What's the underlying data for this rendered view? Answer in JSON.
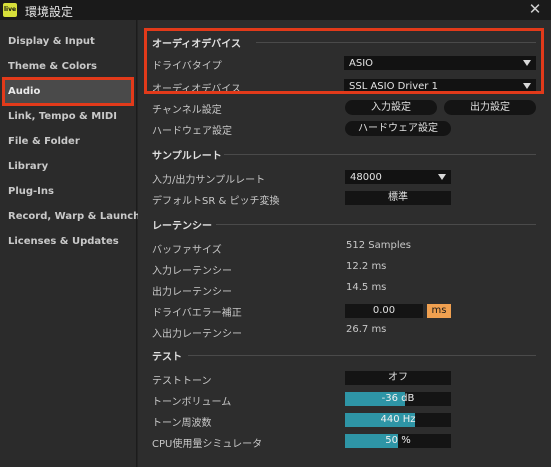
{
  "window": {
    "title": "環境設定",
    "app_icon_text": "live"
  },
  "sidebar": {
    "items": [
      {
        "label": "Display & Input"
      },
      {
        "label": "Theme & Colors"
      },
      {
        "label": "Audio",
        "active": true
      },
      {
        "label": "Link, Tempo & MIDI"
      },
      {
        "label": "File & Folder"
      },
      {
        "label": "Library"
      },
      {
        "label": "Plug-Ins"
      },
      {
        "label": "Record, Warp & Launch"
      },
      {
        "label": "Licenses & Updates"
      }
    ]
  },
  "audio_device": {
    "heading": "オーディオデバイス",
    "driver_type_label": "ドライバタイプ",
    "driver_type_value": "ASIO",
    "device_label": "オーディオデバイス",
    "device_value": "SSL ASIO Driver 1",
    "channel_label": "チャンネル設定",
    "input_settings": "入力設定",
    "output_settings": "出力設定",
    "hardware_label": "ハードウェア設定",
    "hardware_button": "ハードウェア設定"
  },
  "sample_rate": {
    "heading": "サンプルレート",
    "io_label": "入力/出力サンプルレート",
    "io_value": "48000",
    "default_label": "デフォルトSR & ピッチ変換",
    "default_value": "標準"
  },
  "latency": {
    "heading": "レーテンシー",
    "buffer_label": "バッファサイズ",
    "buffer_value": "512 Samples",
    "input_label": "入力レーテンシー",
    "input_value": "12.2 ms",
    "output_label": "出力レーテンシー",
    "output_value": "14.5 ms",
    "driver_comp_label": "ドライバエラー補正",
    "driver_comp_value": "0.00",
    "driver_comp_unit": "ms",
    "overall_label": "入出力レーテンシー",
    "overall_value": "26.7 ms"
  },
  "test": {
    "heading": "テスト",
    "tone_label": "テストトーン",
    "tone_value": "オフ",
    "volume_label": "トーンボリューム",
    "volume_value": "-36 dB",
    "volume_fraction": 0.57,
    "freq_label": "トーン周波数",
    "freq_value": "440 Hz",
    "freq_fraction": 0.66,
    "cpu_label": "CPU使用量シミュレータ",
    "cpu_value": "50 %",
    "cpu_fraction": 0.5
  },
  "colors": {
    "highlight": "#e23a1a",
    "accent_meter": "#2e95a6",
    "ms_badge": "#f0a050",
    "app_icon": "#d8e03a"
  }
}
